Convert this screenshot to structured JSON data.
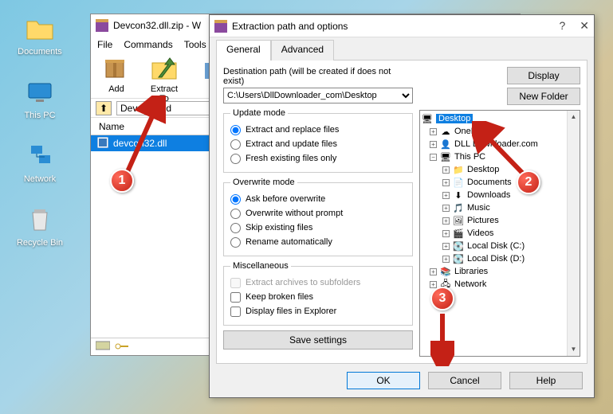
{
  "desktop": {
    "icons": [
      "Documents",
      "This PC",
      "Network",
      "Recycle Bin"
    ]
  },
  "winrar": {
    "title": "Devcon32.dll.zip - W",
    "menu": [
      "File",
      "Commands",
      "Tools"
    ],
    "toolbar": [
      {
        "label": "Add"
      },
      {
        "label": "Extract To"
      }
    ],
    "path": "Devcon32.d",
    "list_header": "Name",
    "selected_file": "devcon32.dll"
  },
  "dlg": {
    "title": "Extraction path and options",
    "tabs": [
      "General",
      "Advanced"
    ],
    "dest_label": "Destination path (will be created if does not exist)",
    "dest_value": "C:\\Users\\DllDownloader_com\\Desktop",
    "display_btn": "Display",
    "newfolder_btn": "New Folder",
    "update_mode": {
      "legend": "Update mode",
      "opts": [
        "Extract and replace files",
        "Extract and update files",
        "Fresh existing files only"
      ]
    },
    "overwrite_mode": {
      "legend": "Overwrite mode",
      "opts": [
        "Ask before overwrite",
        "Overwrite without prompt",
        "Skip existing files",
        "Rename automatically"
      ]
    },
    "misc": {
      "legend": "Miscellaneous",
      "opts": [
        "Extract archives to subfolders",
        "Keep broken files",
        "Display files in Explorer"
      ]
    },
    "save_btn": "Save settings",
    "tree": {
      "root": "Desktop",
      "items": [
        "OneDri",
        "DLL Downloader.com",
        "This PC",
        "Desktop",
        "Documents",
        "Downloads",
        "Music",
        "Pictures",
        "Videos",
        "Local Disk (C:)",
        "Local Disk (D:)",
        "Libraries",
        "Network"
      ]
    },
    "ok": "OK",
    "cancel": "Cancel",
    "help": "Help"
  },
  "callouts": [
    "1",
    "2",
    "3"
  ]
}
